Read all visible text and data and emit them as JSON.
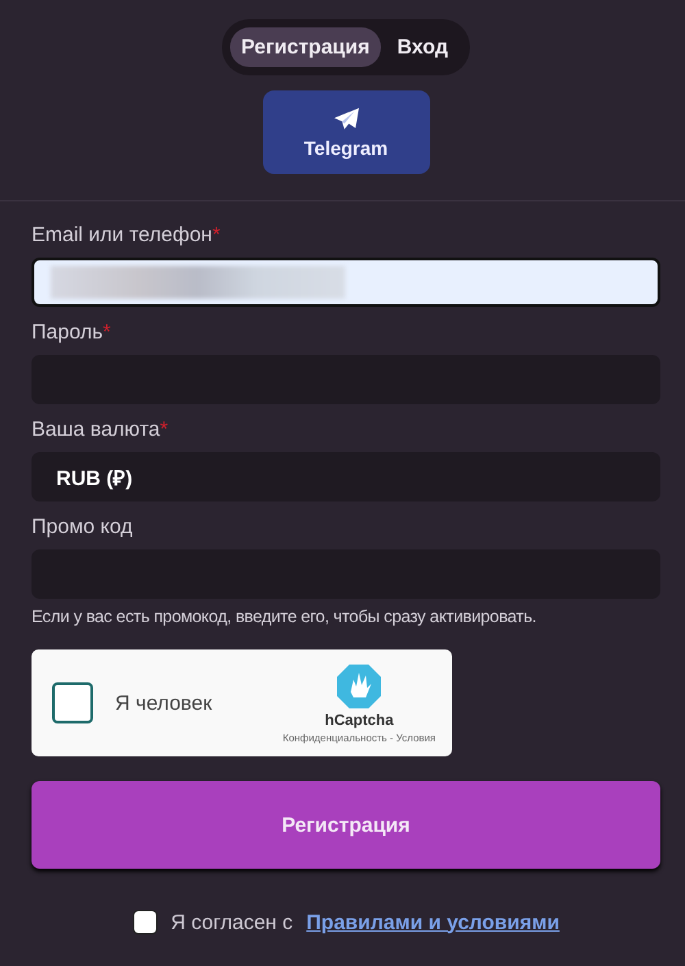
{
  "tabs": [
    {
      "label": "Регистрация",
      "selected": true
    },
    {
      "label": "Вход",
      "selected": false
    }
  ],
  "social": {
    "label": "Telegram"
  },
  "fields": [
    {
      "label": "Email или телефон",
      "required_mark": "*",
      "autofilled": true,
      "value_hidden": true
    },
    {
      "label": "Пароль",
      "required_mark": "*",
      "autofilled": false
    },
    {
      "label": "Ваша валюта",
      "required_mark": "*",
      "autofilled": false,
      "value": "RUB (₽)"
    },
    {
      "label": "Промо код",
      "autofilled": false,
      "hint": "Если у вас есть промокод, введите его, чтобы сразу активировать."
    }
  ],
  "captcha": {
    "label": "Я человек",
    "checked": false,
    "brand": "hCaptcha",
    "links": "Конфиденциальность - Условия"
  },
  "submit": {
    "label": "Регистрация"
  },
  "agreement": {
    "checked": false,
    "text": "Я согласен с",
    "link": "Правилами и условиями"
  }
}
